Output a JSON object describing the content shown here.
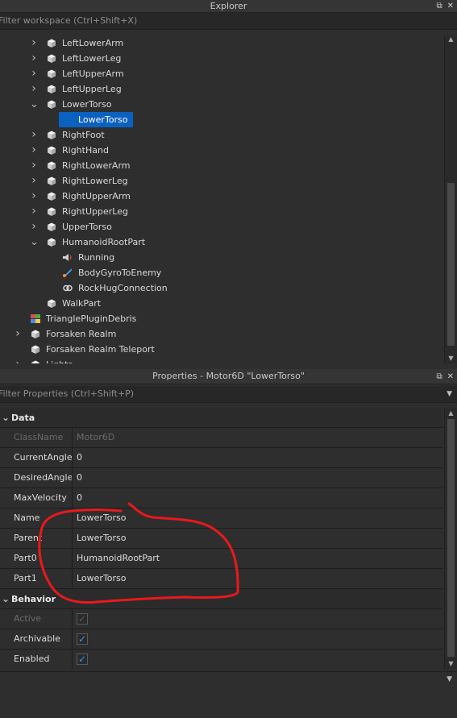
{
  "explorer": {
    "title": "Explorer",
    "filter_placeholder": "Filter workspace (Ctrl+Shift+X)",
    "items": [
      {
        "label": "LeftLowerArm",
        "icon": "part-icon",
        "chevron": "right"
      },
      {
        "label": "LeftLowerLeg",
        "icon": "part-icon",
        "chevron": "right"
      },
      {
        "label": "LeftUpperArm",
        "icon": "part-icon",
        "chevron": "right"
      },
      {
        "label": "LeftUpperLeg",
        "icon": "part-icon",
        "chevron": "right"
      },
      {
        "label": "LowerTorso",
        "icon": "part-icon",
        "chevron": "down"
      },
      {
        "label": "LowerTorso",
        "icon": "motor6d-icon",
        "chevron": "",
        "selected": true
      },
      {
        "label": "RightFoot",
        "icon": "part-icon",
        "chevron": "right"
      },
      {
        "label": "RightHand",
        "icon": "part-icon",
        "chevron": "right"
      },
      {
        "label": "RightLowerArm",
        "icon": "part-icon",
        "chevron": "right"
      },
      {
        "label": "RightLowerLeg",
        "icon": "part-icon",
        "chevron": "right"
      },
      {
        "label": "RightUpperArm",
        "icon": "part-icon",
        "chevron": "right"
      },
      {
        "label": "RightUpperLeg",
        "icon": "part-icon",
        "chevron": "right"
      },
      {
        "label": "UpperTorso",
        "icon": "part-icon",
        "chevron": "right"
      },
      {
        "label": "HumanoidRootPart",
        "icon": "part-icon",
        "chevron": "down"
      },
      {
        "label": "Running",
        "icon": "sound-icon",
        "chevron": ""
      },
      {
        "label": "BodyGyroToEnemy",
        "icon": "bodygyro-icon",
        "chevron": ""
      },
      {
        "label": "RockHugConnection",
        "icon": "weld-icon",
        "chevron": ""
      },
      {
        "label": "WalkPart",
        "icon": "part-icon",
        "chevron": ""
      },
      {
        "label": "TrianglePluginDebris",
        "icon": "model-icon",
        "chevron": ""
      },
      {
        "label": "Forsaken Realm",
        "icon": "part-icon",
        "chevron": "right"
      },
      {
        "label": "Forsaken Realm Teleport",
        "icon": "part-icon",
        "chevron": ""
      },
      {
        "label": "Lights",
        "icon": "part-icon",
        "chevron": "right"
      }
    ]
  },
  "properties": {
    "title": "Properties - Motor6D \"LowerTorso\"",
    "filter_placeholder": "Filter Properties (Ctrl+Shift+P)",
    "sections": [
      {
        "name": "Data",
        "rows": [
          {
            "name": "ClassName",
            "value": "Motor6D",
            "disabled": true
          },
          {
            "name": "CurrentAngle",
            "value": "0"
          },
          {
            "name": "DesiredAngle",
            "value": "0"
          },
          {
            "name": "MaxVelocity",
            "value": "0"
          },
          {
            "name": "Name",
            "value": "LowerTorso"
          },
          {
            "name": "Parent",
            "value": "LowerTorso"
          },
          {
            "name": "Part0",
            "value": "HumanoidRootPart"
          },
          {
            "name": "Part1",
            "value": "LowerTorso"
          }
        ]
      },
      {
        "name": "Behavior",
        "rows": [
          {
            "name": "Active",
            "checked": true,
            "disabled": true
          },
          {
            "name": "Archivable",
            "checked": true
          },
          {
            "name": "Enabled",
            "checked": true
          }
        ]
      }
    ]
  },
  "colors": {
    "selection": "#0b61c0",
    "annotation": "#e8191d",
    "checkbox_accent": "#2f9cff"
  }
}
